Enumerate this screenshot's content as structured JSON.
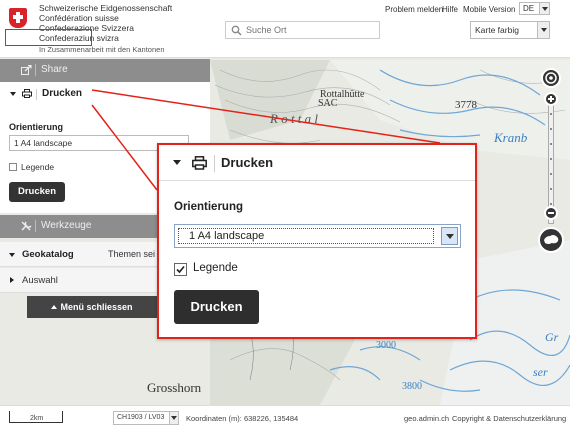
{
  "header": {
    "federation_lines": [
      "Schweizerische Eidgenossenschaft",
      "Confédération suisse",
      "Confederazione Svizzera",
      "Confederaziun svizra"
    ],
    "tagline": "In Zusammenarbeit mit den Kantonen",
    "search_placeholder": "Suche Ort",
    "links": {
      "problem": "Problem melden",
      "help": "Hilfe",
      "mobile": "Mobile Version"
    },
    "language": "DE",
    "basemap": "Karte farbig"
  },
  "panel": {
    "share_label": "Share",
    "print_label": "Drucken",
    "orientation_label": "Orientierung",
    "orientation_value": "1 A4 landscape",
    "legend_label": "Legende",
    "print_button": "Drucken",
    "tools_label": "Werkzeuge",
    "geocatalog_label": "Geokatalog",
    "themes_text": "Themen sei",
    "selection_label": "Auswahl",
    "close_menu": "Menü schliessen"
  },
  "popup": {
    "title": "Drucken",
    "orientation_label": "Orientierung",
    "orientation_value": "1 A4 landscape",
    "legend_label": "Legende",
    "legend_checked": true,
    "print_button": "Drucken"
  },
  "map_labels": {
    "horn_top": "horn",
    "rottalhutte": "Rottalhütte",
    "sac": "SAC",
    "rottal": "R o t t a l",
    "elev_3778": "3778",
    "elev_3000": "3000",
    "elev_3800": "3800",
    "grosshorn": "Grosshorn",
    "kran": "Kranb",
    "ser": "ser",
    "gr": "Gr"
  },
  "footer": {
    "scale": "2km",
    "crs": "CH1903 / LV03",
    "coordinates": "Koordinaten (m): 638226, 135484",
    "site": "geo.admin.ch",
    "copyright": "Copyright & Datenschutzerklärung"
  },
  "colors": {
    "accent_red": "#e32219",
    "swiss_red": "#d8232a",
    "panel_gray": "#8d8d8d",
    "button_dark": "#2e2e2e",
    "water_blue": "#6fa6d6"
  }
}
